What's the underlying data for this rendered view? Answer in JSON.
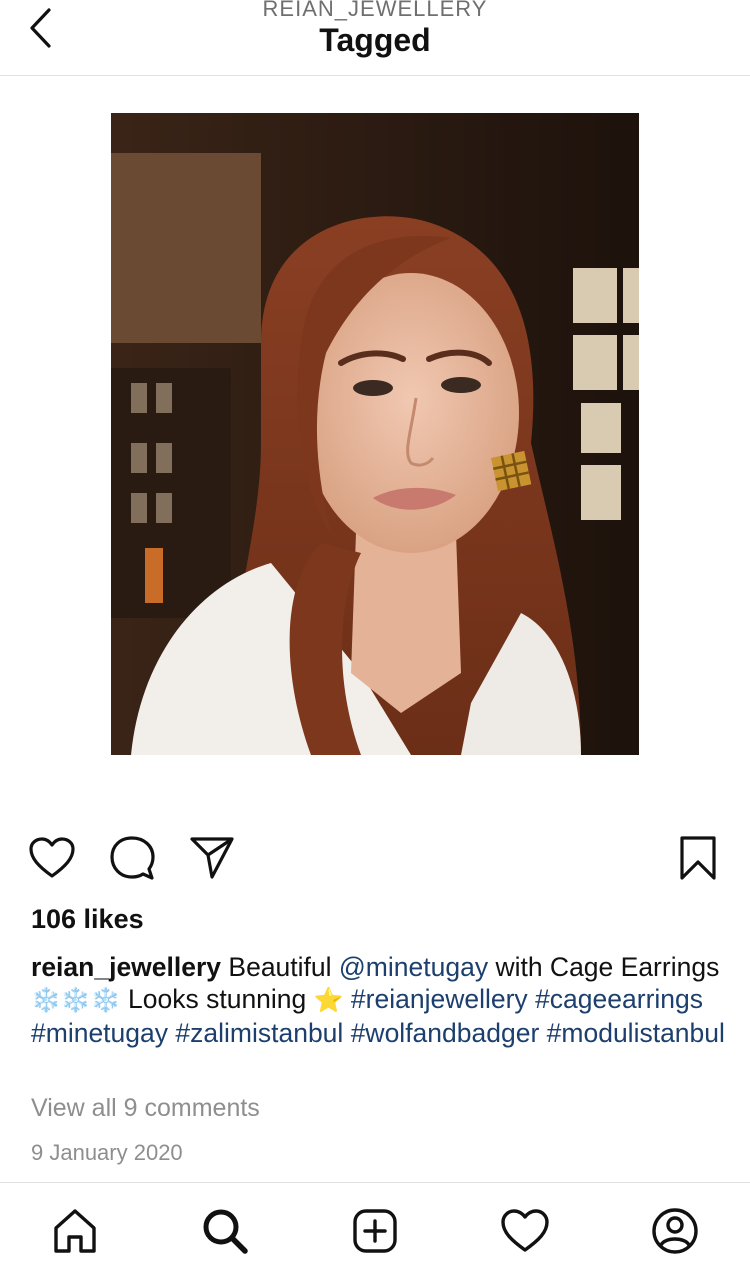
{
  "header": {
    "account": "REIAN_JEWELLERY",
    "title": "Tagged",
    "back_icon": "chevron-left-icon"
  },
  "post": {
    "image_alt": "Woman with auburn wavy hair wearing a gold cage earring",
    "likes": "106 likes",
    "caption": {
      "username": "reian_jewellery",
      "text_1": " Beautiful ",
      "mention": "@minetugay",
      "text_2": " with Cage Earrings ",
      "emoji_snow": "❄️❄️❄️",
      "text_3": " Looks stunning ",
      "emoji_star": "⭐",
      "text_4": " ",
      "hashtags": [
        "#reianjewellery",
        "#cageearrings",
        "#minetugay",
        "#zalimistanbul",
        "#wolfandbadger",
        "#modulistanbul"
      ]
    },
    "view_comments": "View all 9 comments",
    "date": "9 January 2020"
  },
  "actions": {
    "icons": [
      "heart-icon",
      "comment-icon",
      "share-icon",
      "bookmark-icon"
    ]
  },
  "tabbar": {
    "icons": [
      "home-icon",
      "search-icon",
      "create-icon",
      "activity-icon",
      "profile-icon"
    ]
  },
  "colors": {
    "link": "#1c3f6e",
    "muted": "#8e8e8e",
    "divider": "#e2e2e2"
  }
}
